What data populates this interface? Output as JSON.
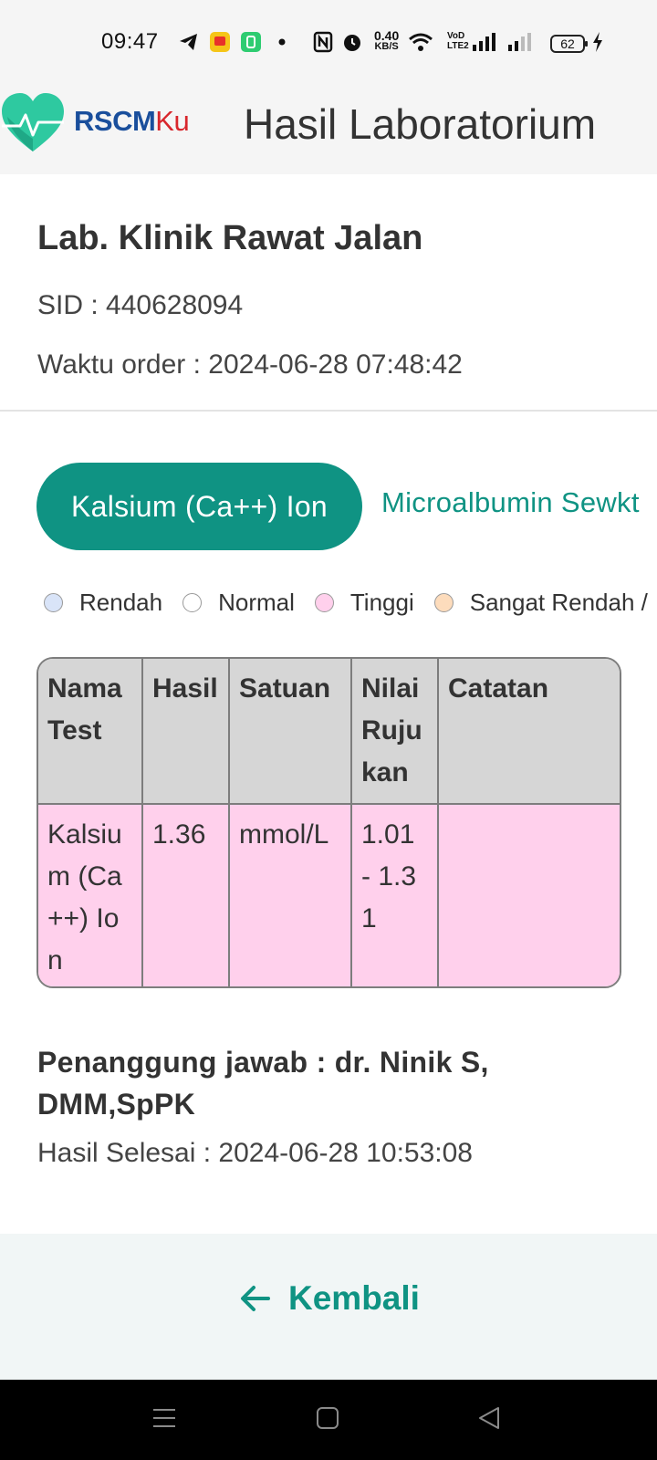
{
  "status_bar": {
    "time": "09:47",
    "speed_value": "0.40",
    "speed_unit": "KB/S",
    "volte_top": "VoD",
    "volte_bottom": "LTE2",
    "battery": "62",
    "icons": [
      "telegram-icon",
      "app-badge-icon",
      "app-square-icon",
      "dot-icon",
      "nfc-icon",
      "alarm-icon",
      "wifi-icon",
      "signal-icon",
      "signal-weak-icon",
      "charging-icon"
    ]
  },
  "header": {
    "brand_part1": "RSCM",
    "brand_part2": "Ku",
    "title": "Hasil Laboratorium",
    "colors": {
      "brand_blue": "#1a4f9c",
      "brand_red": "#d8262c",
      "logo_green": "#2ec9a0"
    }
  },
  "lab": {
    "name": "Lab. Klinik Rawat Jalan",
    "sid": "SID : 440628094",
    "order_time": "Waktu order : 2024-06-28 07:48:42"
  },
  "tabs": [
    {
      "label": "Kalsium (Ca++) Ion",
      "active": true
    },
    {
      "label": "Microalbumin Sewkt",
      "active": false
    }
  ],
  "legend": [
    {
      "label": "Rendah",
      "color": "#d9e4f8"
    },
    {
      "label": "Normal",
      "color": "#ffffff"
    },
    {
      "label": "Tinggi",
      "color": "#ffd0ec"
    },
    {
      "label": "Sangat Rendah /",
      "color": "#fddcbc"
    }
  ],
  "table": {
    "headers": [
      "Nama Test",
      "Hasil",
      "Satuan",
      "Nilai Rujukan",
      "Catatan"
    ],
    "rows": [
      {
        "name": "Kalsium (Ca++) Ion",
        "result": "1.36",
        "unit": "mmol/L",
        "reference": "1.01 - 1.31",
        "note": ""
      }
    ]
  },
  "responsible": "Penanggung jawab : dr. Ninik S, DMM,SpPK",
  "finished": "Hasil Selesai : 2024-06-28 10:53:08",
  "footer": {
    "back_label": "Kembali"
  },
  "accent_color": "#0f9383",
  "nav_bar": {
    "buttons": [
      "menu-icon",
      "home-icon",
      "back-icon"
    ]
  }
}
